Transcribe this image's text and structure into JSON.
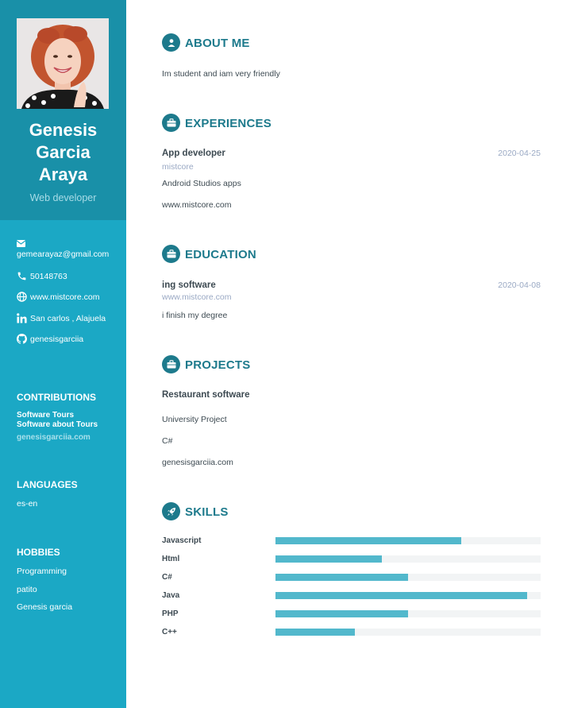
{
  "profile": {
    "name_line1": "Genesis",
    "name_line2": "Garcia",
    "name_line3": "Araya",
    "role": "Web developer"
  },
  "contact": {
    "email": "gemearayaz@gmail.com",
    "phone": "50148763",
    "website": "www.mistcore.com",
    "location": "San carlos , Alajuela",
    "github": "genesisgarciia"
  },
  "contributions": {
    "heading": "CONTRIBUTIONS",
    "title": "Software Tours",
    "description": "Software about Tours",
    "link": "genesisgarciia.com"
  },
  "languages": {
    "heading": "LANGUAGES",
    "value": "es-en"
  },
  "hobbies": {
    "heading": "HOBBIES",
    "items": [
      "Programming",
      "patito",
      "Genesis garcia"
    ]
  },
  "about": {
    "heading": "ABOUT ME",
    "text": "Im student and iam very friendly"
  },
  "experiences": {
    "heading": "EXPERIENCES",
    "items": [
      {
        "title": "App developer",
        "company": "mistcore",
        "date": "2020-04-25",
        "description": "Android Studios apps",
        "url": "www.mistcore.com"
      }
    ]
  },
  "education": {
    "heading": "EDUCATION",
    "items": [
      {
        "title": "ing software",
        "institution": "www.mistcore.com",
        "date": "2020-04-08",
        "description": "i finish my degree"
      }
    ]
  },
  "projects": {
    "heading": "PROJECTS",
    "items": [
      {
        "title": "Restaurant software",
        "description": "University Project",
        "tech": "C#",
        "url": "genesisgarciia.com"
      }
    ]
  },
  "skills": {
    "heading": "SKILLS",
    "items": [
      {
        "name": "Javascript",
        "level": 0.7
      },
      {
        "name": "Html",
        "level": 0.4
      },
      {
        "name": "C#",
        "level": 0.5
      },
      {
        "name": "Java",
        "level": 0.95
      },
      {
        "name": "PHP",
        "level": 0.5
      },
      {
        "name": "C++",
        "level": 0.3
      }
    ]
  },
  "colors": {
    "sidebar": "#1ba8c5",
    "sidebar_top": "#1990a8",
    "accent": "#1d7a8c",
    "skill_bar": "#52b8cc"
  }
}
